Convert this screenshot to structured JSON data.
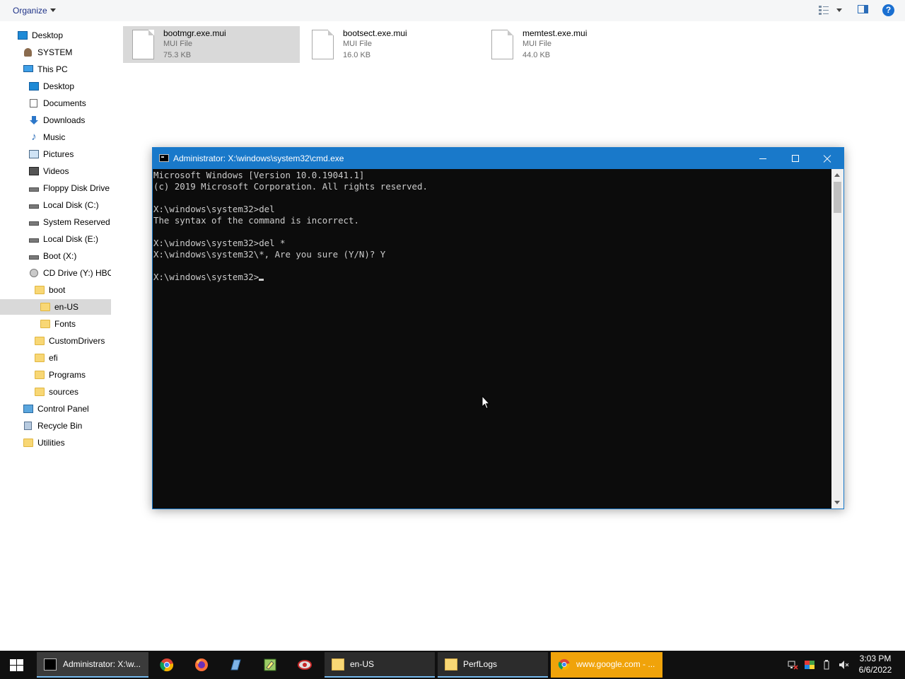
{
  "toolbar": {
    "organize": "Organize",
    "help": "?"
  },
  "sidebar": {
    "items": [
      {
        "label": "Desktop",
        "icon": "desktop-icon"
      },
      {
        "label": "SYSTEM",
        "icon": "user-icon"
      },
      {
        "label": "This PC",
        "icon": "pc-icon"
      },
      {
        "label": "Desktop",
        "icon": "desktop-icon"
      },
      {
        "label": "Documents",
        "icon": "documents-icon"
      },
      {
        "label": "Downloads",
        "icon": "download-icon"
      },
      {
        "label": "Music",
        "icon": "music-icon"
      },
      {
        "label": "Pictures",
        "icon": "pictures-icon"
      },
      {
        "label": "Videos",
        "icon": "videos-icon"
      },
      {
        "label": "Floppy Disk Drive",
        "icon": "floppy-drive-icon"
      },
      {
        "label": "Local Disk (C:)",
        "icon": "drive-icon"
      },
      {
        "label": "System Reserved (",
        "icon": "drive-icon"
      },
      {
        "label": "Local Disk (E:)",
        "icon": "drive-icon"
      },
      {
        "label": "Boot (X:)",
        "icon": "drive-icon"
      },
      {
        "label": "CD Drive (Y:) HBC",
        "icon": "cd-drive-icon"
      },
      {
        "label": "boot",
        "icon": "folder-icon"
      },
      {
        "label": "en-US",
        "icon": "folder-icon"
      },
      {
        "label": "Fonts",
        "icon": "folder-icon"
      },
      {
        "label": "CustomDrivers",
        "icon": "folder-icon"
      },
      {
        "label": "efi",
        "icon": "folder-icon"
      },
      {
        "label": "Programs",
        "icon": "folder-icon"
      },
      {
        "label": "sources",
        "icon": "folder-icon"
      },
      {
        "label": "Control Panel",
        "icon": "control-panel-icon"
      },
      {
        "label": "Recycle Bin",
        "icon": "recycle-bin-icon"
      },
      {
        "label": "Utilities",
        "icon": "folder-icon"
      }
    ]
  },
  "files": [
    {
      "name": "bootmgr.exe.mui",
      "type": "MUI File",
      "size": "75.3 KB"
    },
    {
      "name": "bootsect.exe.mui",
      "type": "MUI File",
      "size": "16.0 KB"
    },
    {
      "name": "memtest.exe.mui",
      "type": "MUI File",
      "size": "44.0 KB"
    }
  ],
  "cmd": {
    "title": "Administrator: X:\\windows\\system32\\cmd.exe",
    "lines": [
      "Microsoft Windows [Version 10.0.19041.1]",
      "(c) 2019 Microsoft Corporation. All rights reserved.",
      "",
      "X:\\windows\\system32>del",
      "The syntax of the command is incorrect.",
      "",
      "X:\\windows\\system32>del *",
      "X:\\windows\\system32\\*, Are you sure (Y/N)? Y",
      "",
      "X:\\windows\\system32>"
    ]
  },
  "taskbar": {
    "tasks": [
      {
        "label": "Administrator: X:\\w..."
      },
      {
        "label": "en-US"
      },
      {
        "label": "PerfLogs"
      },
      {
        "label": "www.google.com - ..."
      }
    ],
    "time": "3:03 PM",
    "date": "6/6/2022"
  }
}
